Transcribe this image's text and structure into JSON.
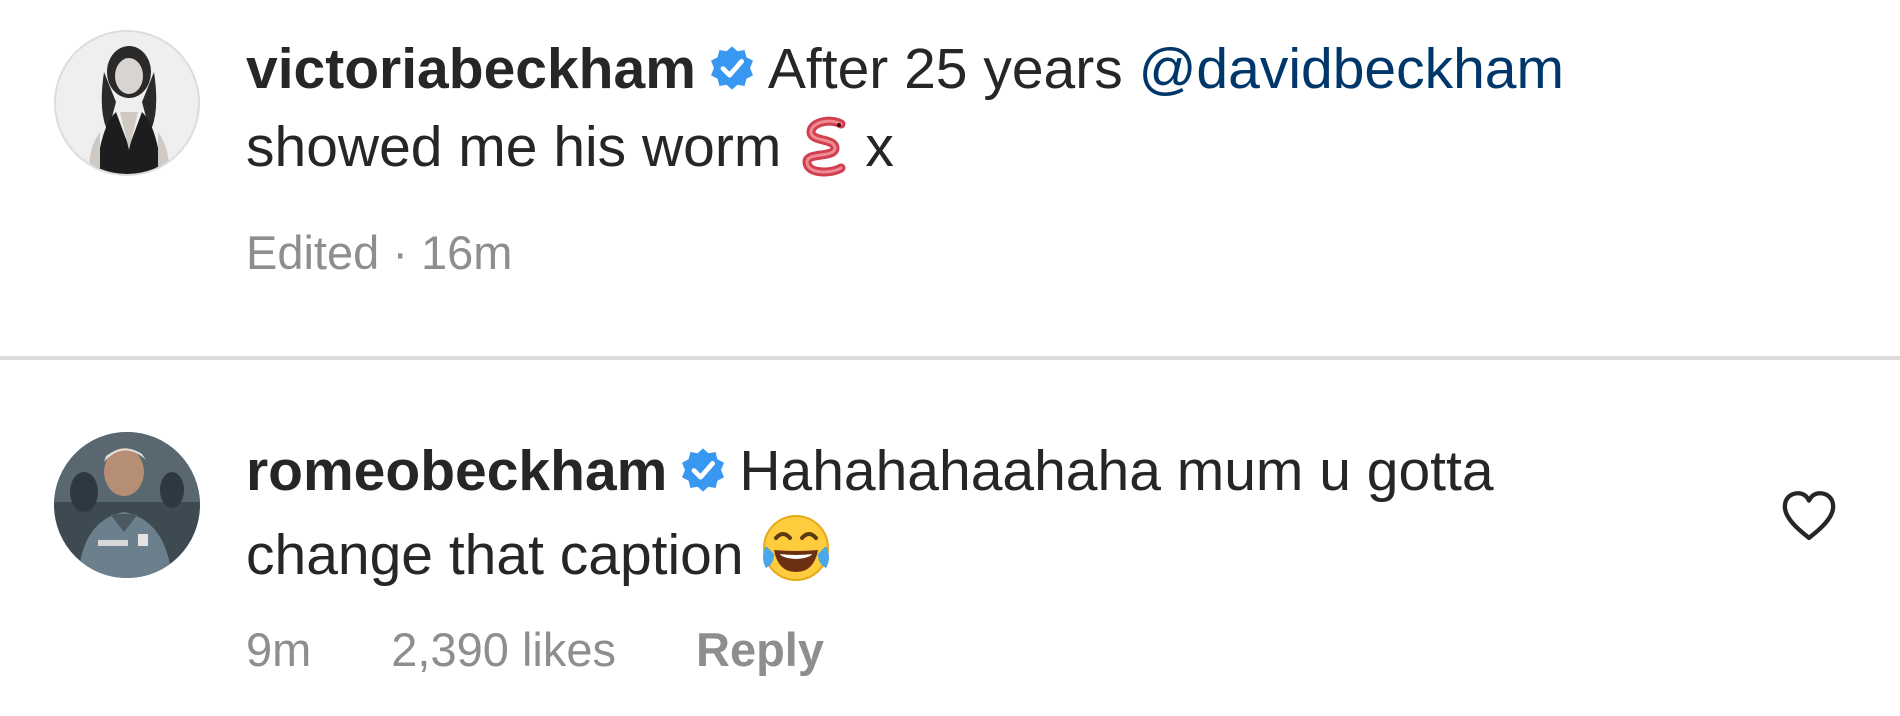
{
  "comments": [
    {
      "username": "victoriabeckham",
      "verified": true,
      "text_before_mention": "After 25 years ",
      "mention": "@davidbeckham",
      "text_line2": "showed  me his worm",
      "emoji": "worm-emoji",
      "text_after_emoji": "x",
      "meta": {
        "edited": "Edited · 16m"
      }
    },
    {
      "username": "romeobeckham",
      "verified": true,
      "text": "Hahahahaahaha mum u gotta change that caption",
      "emoji": "face-with-tears-of-joy-emoji",
      "meta": {
        "time": "9m",
        "likes": "2,390 likes",
        "reply": "Reply"
      },
      "like_icon": "heart-icon"
    }
  ],
  "colors": {
    "text": "#262626",
    "muted": "#8e8e8e",
    "mention": "#00376b",
    "verified": "#3897f0",
    "divider": "#dbdbdb"
  }
}
